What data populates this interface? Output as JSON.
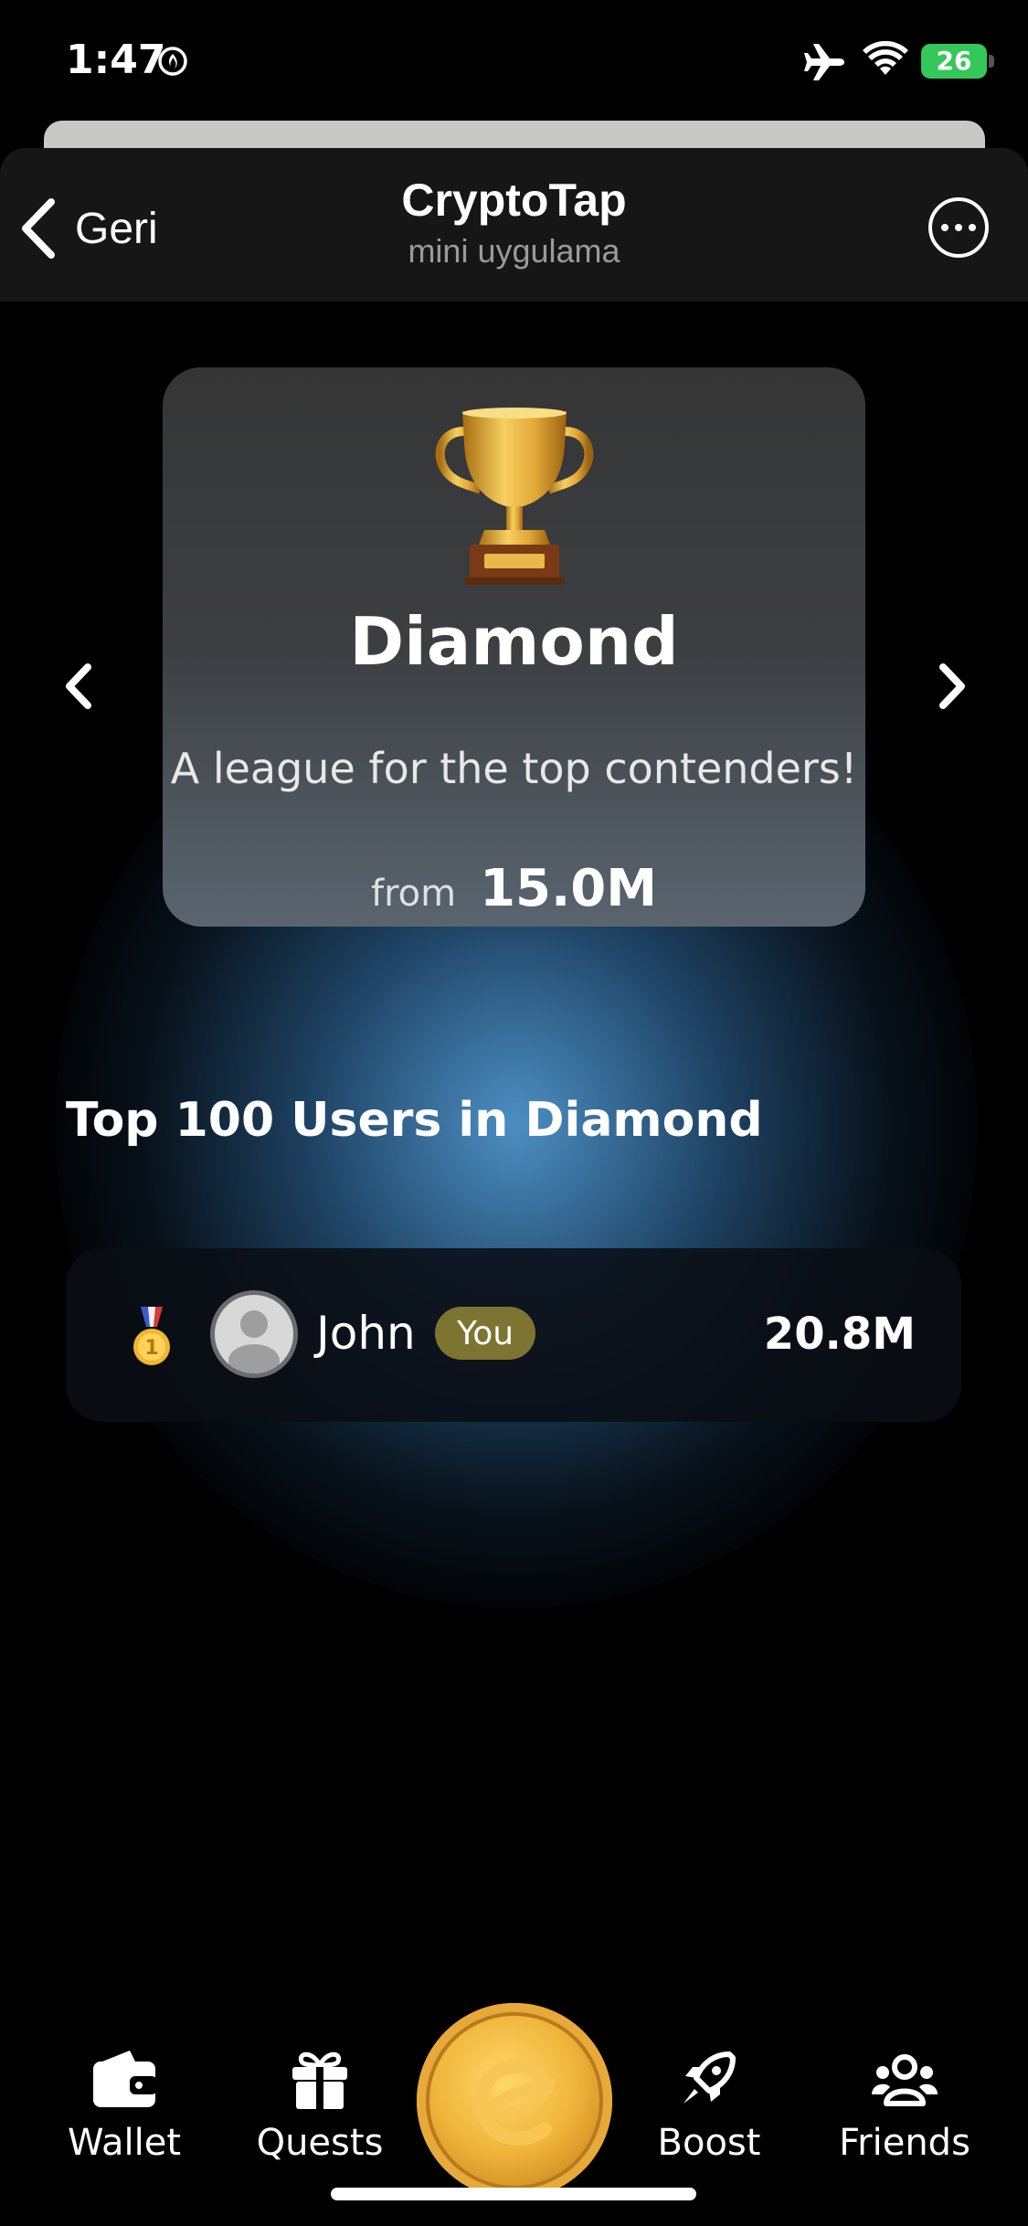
{
  "status_bar": {
    "time": "1:47",
    "battery": "26"
  },
  "header": {
    "back_label": "Geri",
    "title": "CryptoTap",
    "subtitle": "mini uygulama"
  },
  "league_card": {
    "name": "Diamond",
    "description": "A league for the top contenders!",
    "from_label": "from",
    "threshold": "15.0M"
  },
  "leaderboard": {
    "title": "Top 100 Users in Diamond",
    "rows": [
      {
        "rank_medal": "gold-medal",
        "name": "John",
        "badge": "You",
        "score": "20.8M"
      }
    ]
  },
  "bottom_nav": {
    "items": [
      {
        "label": "Wallet",
        "icon": "wallet-icon"
      },
      {
        "label": "Quests",
        "icon": "gift-icon"
      },
      {
        "label": "Boost",
        "icon": "rocket-icon"
      },
      {
        "label": "Friends",
        "icon": "friends-icon"
      }
    ],
    "center_icon": "coin-icon"
  },
  "colors": {
    "background": "#000000",
    "card": "#353535",
    "glow": "#5096cd",
    "badge": "#7d7432",
    "battery": "#34c759",
    "coin": "#f0b43a"
  }
}
